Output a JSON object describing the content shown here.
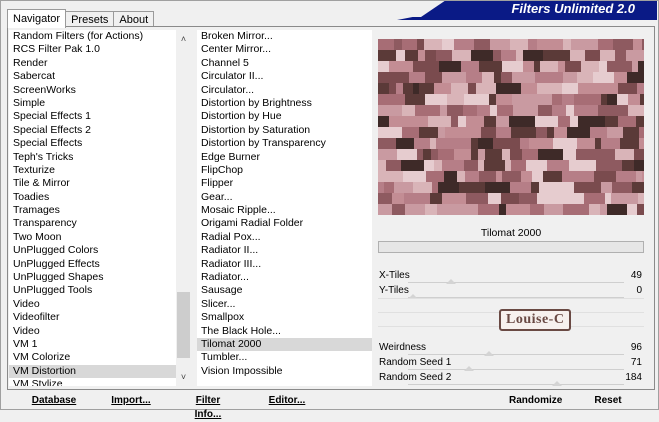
{
  "tabs": [
    "Navigator",
    "Presets",
    "About"
  ],
  "banner_title": "Filters Unlimited 2.0",
  "categories": [
    "Random Filters (for Actions)",
    "RCS Filter Pak 1.0",
    "Render",
    "Sabercat",
    "ScreenWorks",
    "Simple",
    "Special Effects 1",
    "Special Effects 2",
    "Special Effects",
    "Teph's Tricks",
    "Texturize",
    "Tile & Mirror",
    "Toadies",
    "Tramages",
    "Transparency",
    "Two Moon",
    "UnPlugged Colors",
    "UnPlugged Effects",
    "UnPlugged Shapes",
    "UnPlugged Tools",
    "Video",
    "Videofilter",
    "Video",
    "VM 1",
    "VM Colorize",
    "VM Distortion",
    "VM Stylize"
  ],
  "selected_category": "VM Distortion",
  "filters": [
    "Broken Mirror...",
    "Center Mirror...",
    "Channel 5",
    "Circulator II...",
    "Circulator...",
    "Distortion by Brightness",
    "Distortion by Hue",
    "Distortion by Saturation",
    "Distortion by Transparency",
    "Edge Burner",
    "FlipChop",
    "Flipper",
    "Gear...",
    "Mosaic Ripple...",
    "Origami Radial Folder",
    "Radial Pox...",
    "Radiator II...",
    "Radiator III...",
    "Radiator...",
    "Sausage",
    "Slicer...",
    "Smallpox",
    "The Black Hole...",
    "Tilomat 2000",
    "Tumbler...",
    "Vision Impossible"
  ],
  "selected_filter": "Tilomat 2000",
  "filter_title": "Tilomat 2000",
  "progress": 0,
  "params": [
    {
      "label": "X-Tiles",
      "value": "49",
      "level": 0.19
    },
    {
      "label": "Y-Tiles",
      "value": "0",
      "level": 0.0
    },
    {
      "label": "Weirdness",
      "value": "96",
      "level": 0.38
    },
    {
      "label": "Random Seed 1",
      "value": "71",
      "level": 0.28
    },
    {
      "label": "Random Seed 2",
      "value": "184",
      "level": 0.72
    }
  ],
  "logo_text": "Louise-C",
  "buttons": {
    "database": "Database",
    "import": "Import...",
    "filter_info": "Filter Info...",
    "editor": "Editor...",
    "randomize": "Randomize",
    "reset": "Reset"
  },
  "colors": {
    "banner": "#0a1a86",
    "preview_base": "#b67e87",
    "selection": "#d8d8d8"
  },
  "icons": {
    "scroll_up": "chevron-up-icon",
    "scroll_down": "chevron-down-icon"
  }
}
